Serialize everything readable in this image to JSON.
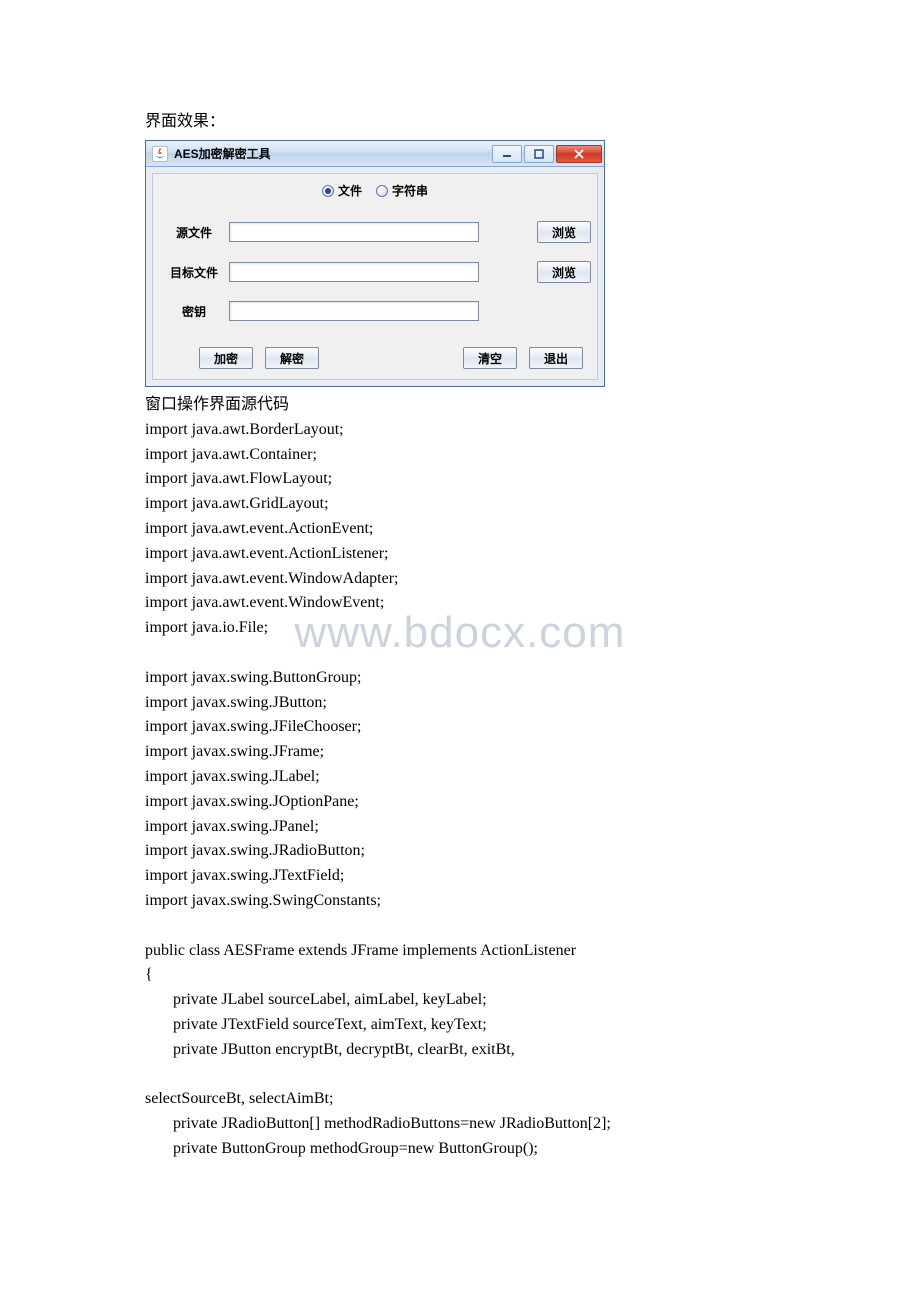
{
  "intro": "界面效果：",
  "window": {
    "title": "AES加密解密工具",
    "radios": {
      "file": "文件",
      "string": "字符串"
    },
    "labels": {
      "source": "源文件",
      "target": "目标文件",
      "key": "密钥"
    },
    "buttons": {
      "browse": "浏览",
      "encrypt": "加密",
      "decrypt": "解密",
      "clear": "清空",
      "exit": "退出"
    }
  },
  "caption": "窗口操作界面源代码",
  "code": [
    "import java.awt.BorderLayout;",
    "import java.awt.Container;",
    "import java.awt.FlowLayout;",
    "import java.awt.GridLayout;",
    "import java.awt.event.ActionEvent;",
    "import java.awt.event.ActionListener;",
    "import java.awt.event.WindowAdapter;",
    "import java.awt.event.WindowEvent;",
    "import java.io.File;",
    "",
    "import javax.swing.ButtonGroup;",
    "import javax.swing.JButton;",
    "import javax.swing.JFileChooser;",
    "import javax.swing.JFrame;",
    "import javax.swing.JLabel;",
    "import javax.swing.JOptionPane;",
    "import javax.swing.JPanel;",
    "import javax.swing.JRadioButton;",
    "import javax.swing.JTextField;",
    "import javax.swing.SwingConstants;",
    "",
    "public class AESFrame extends JFrame implements ActionListener",
    "{",
    "       private JLabel sourceLabel, aimLabel, keyLabel;",
    "       private JTextField sourceText, aimText, keyText;",
    "       private JButton encryptBt, decryptBt, clearBt, exitBt,",
    "",
    "selectSourceBt, selectAimBt;",
    "       private JRadioButton[] methodRadioButtons=new JRadioButton[2];",
    "       private ButtonGroup methodGroup=new ButtonGroup();"
  ],
  "watermark": "www.bdocx.com"
}
